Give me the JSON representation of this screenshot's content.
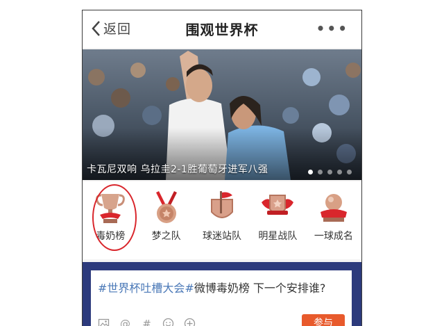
{
  "header": {
    "back_label": "返回",
    "title": "围观世界杯",
    "more_icon": "ellipsis-icon"
  },
  "banner": {
    "caption": "卡瓦尼双响 乌拉圭2-1胜葡萄牙进军八强",
    "slide_count": 5,
    "active_slide": 1
  },
  "categories": [
    {
      "label": "毒奶榜",
      "icon": "trophy-cup-icon",
      "highlighted": true
    },
    {
      "label": "梦之队",
      "icon": "medal-icon",
      "highlighted": false
    },
    {
      "label": "球迷站队",
      "icon": "flag-shield-icon",
      "highlighted": false
    },
    {
      "label": "明星战队",
      "icon": "winged-shield-icon",
      "highlighted": false
    },
    {
      "label": "一球成名",
      "icon": "ball-on-pedestal-icon",
      "highlighted": false
    }
  ],
  "topic": {
    "hashtag": "#世界杯吐槽大会#",
    "text": "微博毒奶榜 下一个安排谁?",
    "join_label": "参与",
    "tools": [
      "image-icon",
      "at-icon",
      "hash-icon",
      "emoji-icon",
      "add-icon"
    ]
  },
  "colors": {
    "accent": "#e85a2c",
    "hashtag": "#4a78b7",
    "topic_bg": "#2c3a7c",
    "highlight_circle": "#d9262c"
  }
}
